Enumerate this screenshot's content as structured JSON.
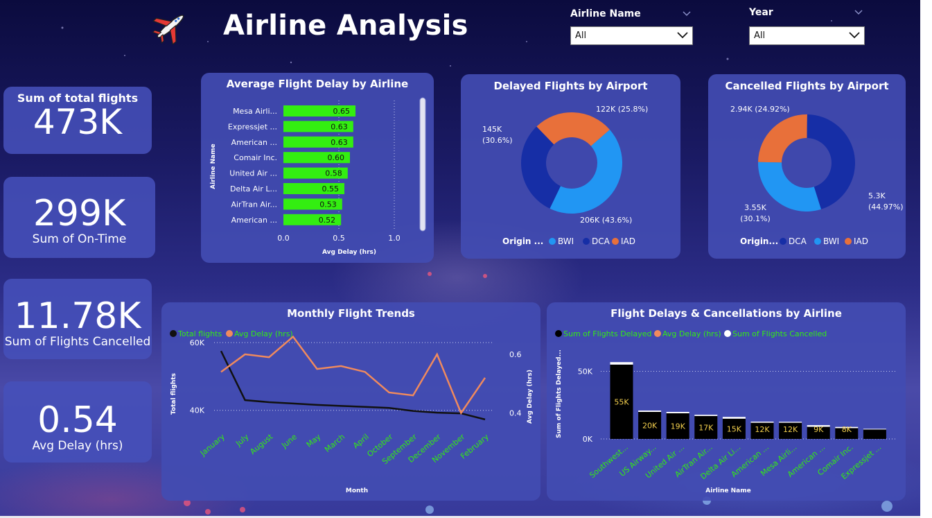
{
  "header": {
    "title": "Airline Analysis",
    "logo_icon": "airplane-icon"
  },
  "filters": [
    {
      "label": "Airline Name",
      "value": "All"
    },
    {
      "label": "Year",
      "value": "All"
    }
  ],
  "kpis": [
    {
      "value": "473K",
      "caption": "Sum of total flights"
    },
    {
      "value": "299K",
      "caption": "Sum of On-Time"
    },
    {
      "value": "11.78K",
      "caption": "Sum of Flights Cancelled"
    },
    {
      "value": "0.54",
      "caption": "Avg Delay (hrs)"
    }
  ],
  "colors": {
    "green": "#33ee11",
    "orange": "#f08a5d",
    "blue_light": "#2196f3",
    "blue_dark": "#162ea6",
    "pie_orange": "#e8703a"
  },
  "chart_data": [
    {
      "type": "bar",
      "title": "Average Flight Delay by Airline",
      "xlabel": "Avg Delay (hrs)",
      "ylabel": "Airline Name",
      "categories": [
        "Mesa Airli...",
        "Expressjet ...",
        "American ...",
        "Comair Inc.",
        "United Air ...",
        "Delta Air L...",
        "AirTran Air...",
        "American ..."
      ],
      "values": [
        0.65,
        0.63,
        0.63,
        0.6,
        0.58,
        0.55,
        0.53,
        0.52
      ],
      "labels": [
        "0.65",
        "0.63",
        "0.63",
        "0.60",
        "0.58",
        "0.55",
        "0.53",
        "0.52"
      ],
      "xticks": [
        "0.0",
        "0.5",
        "1.0"
      ],
      "xlim": [
        0,
        1.0
      ],
      "orientation": "horizontal"
    },
    {
      "type": "pie",
      "title": "Delayed Flights by Airport",
      "legend_title": "Origin ...",
      "slices": [
        {
          "name": "BWI",
          "value": 206,
          "label": "206K (43.6%)"
        },
        {
          "name": "DCA",
          "value": 145,
          "label": "145K (30.6%)"
        },
        {
          "name": "IAD",
          "value": 122,
          "label": "122K (25.8%)"
        }
      ]
    },
    {
      "type": "pie",
      "title": "Cancelled Flights by Airport",
      "legend_title": "Origin...",
      "slices": [
        {
          "name": "DCA",
          "value": 5.3,
          "label": "5.3K (44.97%)"
        },
        {
          "name": "BWI",
          "value": 3.55,
          "label": "3.55K (30.1%)"
        },
        {
          "name": "IAD",
          "value": 2.94,
          "label": "2.94K (24.92%)"
        }
      ]
    },
    {
      "type": "line",
      "title": "Monthly Flight Trends",
      "xlabel": "Month",
      "ylabel": "Total flights",
      "y2label": "Avg Delay (hrs)",
      "categories": [
        "January",
        "July",
        "August",
        "June",
        "May",
        "March",
        "April",
        "October",
        "September",
        "December",
        "November",
        "February"
      ],
      "yticks": [
        "60K",
        "40K"
      ],
      "y2ticks": [
        "0.6",
        "0.4"
      ],
      "ylim": [
        34000,
        60000
      ],
      "y2lim": [
        0.34,
        0.64
      ],
      "series": [
        {
          "name": "Total flights",
          "axis": "left",
          "values": [
            57500,
            43000,
            42400,
            42000,
            41600,
            41300,
            41000,
            40700,
            39800,
            39300,
            39100,
            37300
          ]
        },
        {
          "name": "Avg Delay (hrs)",
          "axis": "right",
          "values": [
            0.54,
            0.6,
            0.59,
            0.66,
            0.55,
            0.56,
            0.54,
            0.47,
            0.46,
            0.6,
            0.4,
            0.52
          ]
        }
      ]
    },
    {
      "type": "bar",
      "title": "Flight Delays & Cancellations by Airline",
      "xlabel": "Airline Name",
      "ylabel": "Sum of Flights Delayed...",
      "categories": [
        "Southwest...",
        "US Airway...",
        "United Air ...",
        "AirTran Air...",
        "Delta Air Li...",
        "American ...",
        "Mesa Airli...",
        "American ...",
        "Comair Inc.",
        "Expressjet ..."
      ],
      "yticks": [
        "50K",
        "0K"
      ],
      "ylim": [
        0,
        60000
      ],
      "series": [
        {
          "name": "Sum of Flights Delayed",
          "values": [
            55000,
            20000,
            19000,
            17000,
            15000,
            12000,
            12000,
            9000,
            8000,
            7000
          ],
          "labels": [
            "55K",
            "20K",
            "19K",
            "17K",
            "15K",
            "12K",
            "12K",
            "9K",
            "8K",
            ""
          ]
        },
        {
          "name": "Avg Delay (hrs)",
          "values": []
        },
        {
          "name": "Sum of Flights Cancelled",
          "values": [
            1800,
            1000,
            1000,
            900,
            1300,
            800,
            700,
            1200,
            900,
            500
          ]
        }
      ]
    }
  ]
}
